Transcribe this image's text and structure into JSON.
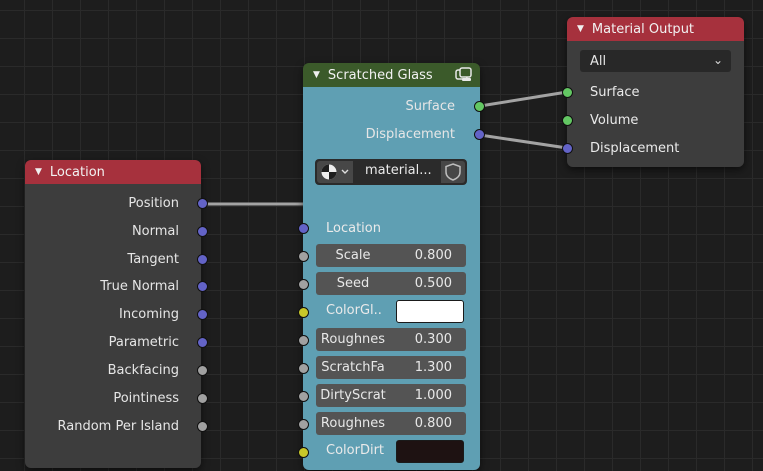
{
  "colors": {
    "grid_bg": "#1d1d1d",
    "header_red": "#a6313d",
    "header_green": "#3b5a2a",
    "group_body": "#5f9fb3",
    "node_body": "#3d3d3d",
    "socket_vector": "#6363c7",
    "socket_float": "#a1a1a1",
    "socket_shader": "#63c763",
    "socket_color": "#c7c729",
    "link": "#a3a3a3"
  },
  "location_node": {
    "title": "Location",
    "outputs": [
      "Position",
      "Normal",
      "Tangent",
      "True Normal",
      "Incoming",
      "Parametric",
      "Backfacing",
      "Pointiness",
      "Random Per Island"
    ]
  },
  "group_node": {
    "title": "Scratched Glass",
    "header_icon": "node-group-icon",
    "outputs": [
      "Surface",
      "Displacement"
    ],
    "datablock": {
      "icon": "material-sphere-icon",
      "name": "material...",
      "fake_user_icon": "shield-icon"
    },
    "location_label": "Location",
    "inputs": {
      "scale": {
        "label": "Scale",
        "value": "0.800"
      },
      "seed": {
        "label": "Seed",
        "value": "0.500"
      },
      "color_glass": {
        "label": "ColorGl..",
        "color": "#ffffff"
      },
      "roughness1": {
        "label": "Roughnes",
        "value": "0.300"
      },
      "scratch_factor": {
        "label": "ScratchFa",
        "value": "1.300"
      },
      "dirty_scratch": {
        "label": "DirtyScrat",
        "value": "1.000"
      },
      "roughness2": {
        "label": "Roughnes",
        "value": "0.800"
      },
      "color_dirt": {
        "label": "ColorDirt",
        "color": "#1e1212"
      }
    }
  },
  "output_node": {
    "title": "Material Output",
    "target": "All",
    "inputs": [
      "Surface",
      "Volume",
      "Displacement"
    ]
  }
}
